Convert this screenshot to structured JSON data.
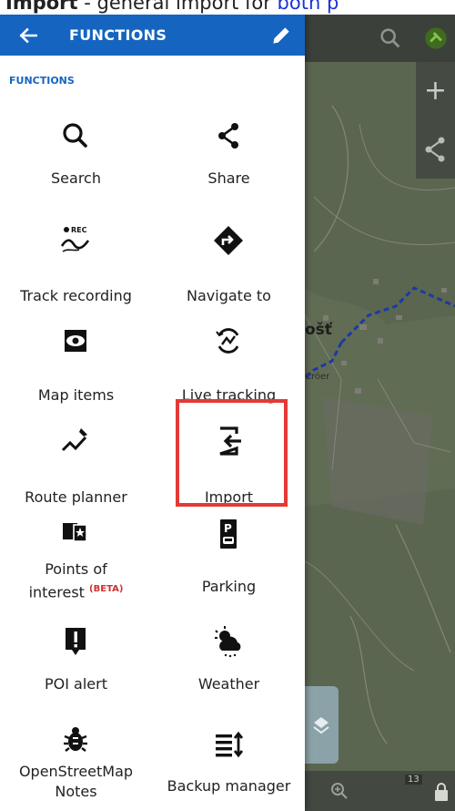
{
  "caption": {
    "bold": "Import",
    "rest": " - general import for ",
    "link": "both p"
  },
  "appbar": {
    "title": "FUNCTIONS"
  },
  "section": {
    "title": "FUNCTIONS"
  },
  "items": {
    "search": "Search",
    "share": "Share",
    "track_recording": "Track recording",
    "navigate_to": "Navigate to",
    "map_items": "Map items",
    "live_tracking": "Live tracking",
    "route_planner": "Route planner",
    "import": "Import",
    "poi_line1": "Points of",
    "poi_line2": "interest",
    "poi_beta": "(BETA)",
    "parking": "Parking",
    "poi_alert": "POI alert",
    "weather": "Weather",
    "osm_line1": "OpenStreetMap",
    "osm_line2": "Notes",
    "backup_manager": "Backup manager"
  },
  "rec_badge": "REC",
  "map": {
    "village": "ošť",
    "road_label": "Cröer",
    "bottom_badge": "13"
  },
  "colors": {
    "accent": "#1565c0",
    "highlight": "#e53935",
    "beta": "#d32f2f"
  }
}
